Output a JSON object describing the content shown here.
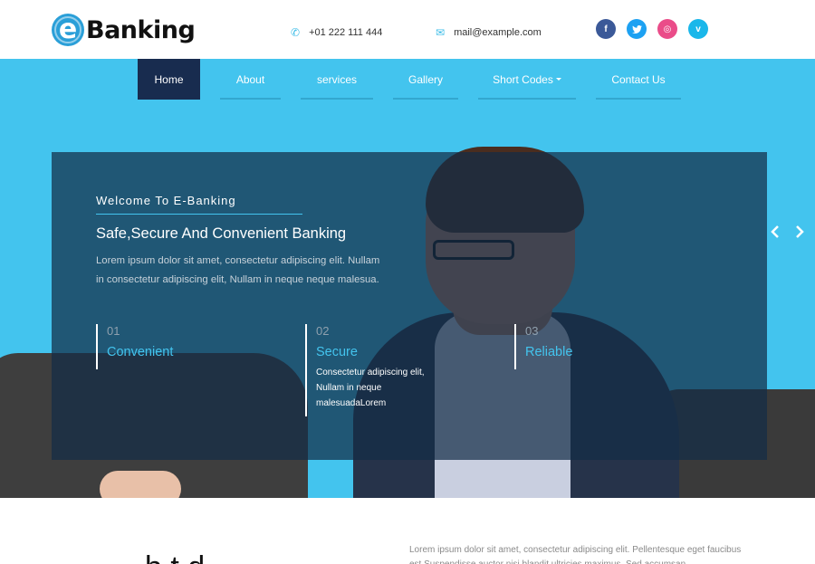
{
  "brand": {
    "logo_letter": "e",
    "name": "Banking"
  },
  "contact": {
    "phone": "+01 222 111 444",
    "email": "mail@example.com",
    "phone_icon": "phone-icon",
    "email_icon": "mail-icon"
  },
  "social": [
    {
      "name": "facebook",
      "glyph": "f",
      "color": "#3b5998"
    },
    {
      "name": "twitter",
      "glyph": "t",
      "color": "#1da1f2"
    },
    {
      "name": "dribbble",
      "glyph": "◎",
      "color": "#ea4c89"
    },
    {
      "name": "vimeo",
      "glyph": "v",
      "color": "#1ab7ea"
    }
  ],
  "nav": {
    "items": [
      {
        "label": "Home",
        "active": true
      },
      {
        "label": "About"
      },
      {
        "label": "services"
      },
      {
        "label": "Gallery"
      },
      {
        "label": "Short Codes",
        "dropdown": true
      },
      {
        "label": "Contact Us"
      }
    ]
  },
  "hero": {
    "welcome": "Welcome To E-Banking",
    "title": "Safe,Secure And Convenient Banking",
    "description": "Lorem ipsum dolor sit amet, consectetur adipiscing elit. Nullam in consectetur adipiscing elit, Nullam in neque neque malesua.",
    "features": [
      {
        "num": "01",
        "name": "Convenient",
        "text": ""
      },
      {
        "num": "02",
        "name": "Secure",
        "text": "Consectetur adipiscing elit, Nullam in neque malesuadaLorem"
      },
      {
        "num": "03",
        "name": "Reliable",
        "text": ""
      }
    ],
    "prev_glyph": "‹",
    "next_glyph": "›"
  },
  "below": {
    "heading_partial": "b t d",
    "text": "Lorem ipsum dolor sit amet, consectetur adipiscing elit. Pellentesque eget faucibus est Suspendisse auctor nisi blandit ultricies maximus. Sed accumsan"
  },
  "colors": {
    "accent": "#43c4ee",
    "nav_active": "#182c4f",
    "overlay": "#142d46"
  }
}
